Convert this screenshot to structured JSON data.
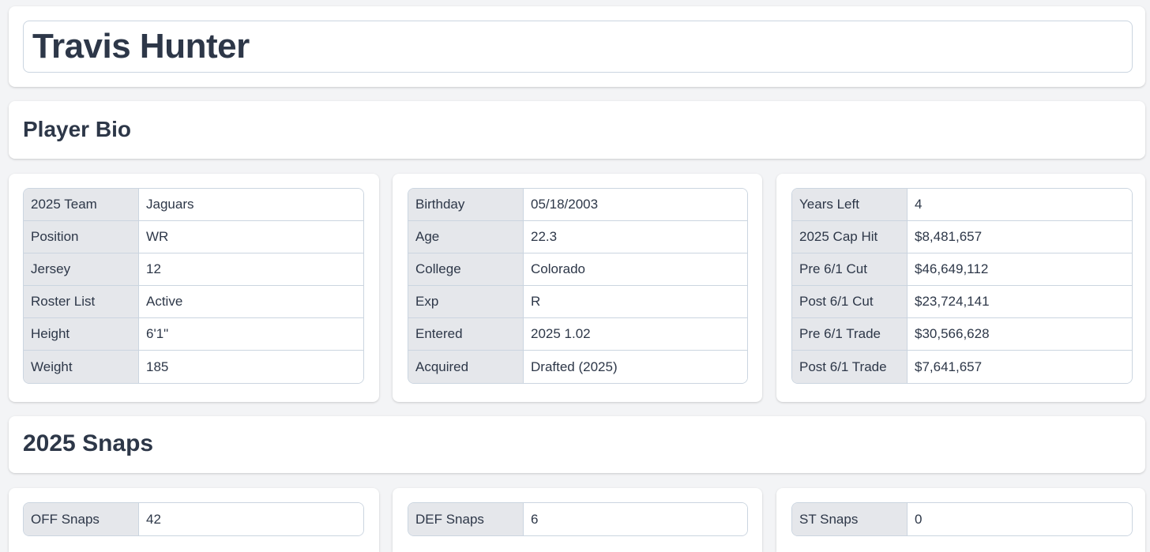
{
  "player": {
    "name": "Travis Hunter"
  },
  "bio": {
    "heading": "Player Bio",
    "col1": [
      {
        "label": "2025 Team",
        "value": "Jaguars"
      },
      {
        "label": "Position",
        "value": "WR"
      },
      {
        "label": "Jersey",
        "value": "12"
      },
      {
        "label": "Roster List",
        "value": "Active"
      },
      {
        "label": "Height",
        "value": "6'1\""
      },
      {
        "label": "Weight",
        "value": "185"
      }
    ],
    "col2": [
      {
        "label": "Birthday",
        "value": "05/18/2003"
      },
      {
        "label": "Age",
        "value": "22.3"
      },
      {
        "label": "College",
        "value": "Colorado"
      },
      {
        "label": "Exp",
        "value": "R"
      },
      {
        "label": "Entered",
        "value": "2025 1.02"
      },
      {
        "label": "Acquired",
        "value": "Drafted (2025)"
      }
    ],
    "col3": [
      {
        "label": "Years Left",
        "value": "4"
      },
      {
        "label": "2025 Cap Hit",
        "value": "$8,481,657"
      },
      {
        "label": "Pre 6/1 Cut",
        "value": "$46,649,112"
      },
      {
        "label": "Post 6/1 Cut",
        "value": "$23,724,141"
      },
      {
        "label": "Pre 6/1 Trade",
        "value": "$30,566,628"
      },
      {
        "label": "Post 6/1 Trade",
        "value": "$7,641,657"
      }
    ]
  },
  "snaps": {
    "heading": "2025 Snaps",
    "off": {
      "label": "OFF Snaps",
      "value": "42"
    },
    "def": {
      "label": "DEF Snaps",
      "value": "6"
    },
    "st": {
      "label": "ST Snaps",
      "value": "0"
    }
  },
  "colors": {
    "label_bg": "#e5e7eb",
    "border": "#cbd5e0",
    "text": "#2d3748",
    "page_bg": "#f3f4f6"
  }
}
